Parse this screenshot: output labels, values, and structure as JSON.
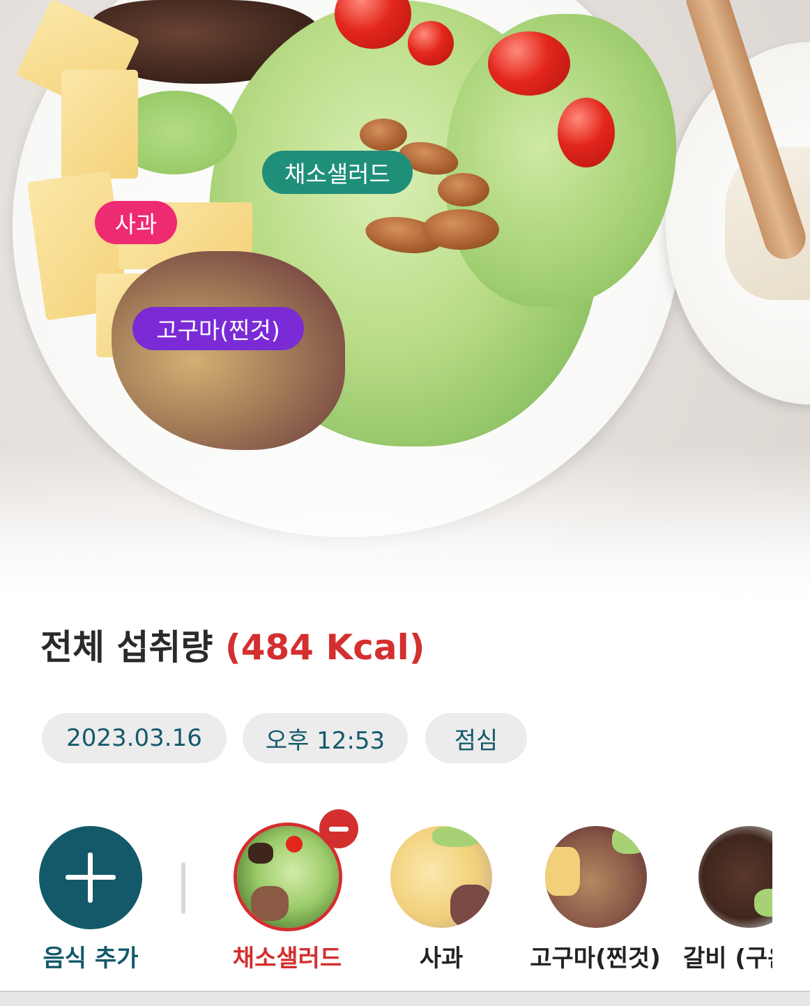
{
  "photo": {
    "food_tags": [
      {
        "label": "채소샐러드",
        "color": "#1f8f7a"
      },
      {
        "label": "사과",
        "color": "#ee2a72"
      },
      {
        "label": "고구마(찐것)",
        "color": "#7a2bd6"
      }
    ]
  },
  "summary": {
    "title": "전체 섭취량",
    "kcal": "(484 Kcal)"
  },
  "meta_chips": {
    "date": "2023.03.16",
    "time": "오후 12:53",
    "meal": "점심"
  },
  "food_list": {
    "add_label": "음식 추가",
    "items": [
      {
        "label": "채소샐러드",
        "selected": true
      },
      {
        "label": "사과",
        "selected": false
      },
      {
        "label": "고구마(찐것)",
        "selected": false
      },
      {
        "label": "갈비 (구운것)",
        "selected": false
      }
    ]
  },
  "colors": {
    "accent_teal": "#13596a",
    "accent_red": "#d32f2f"
  }
}
